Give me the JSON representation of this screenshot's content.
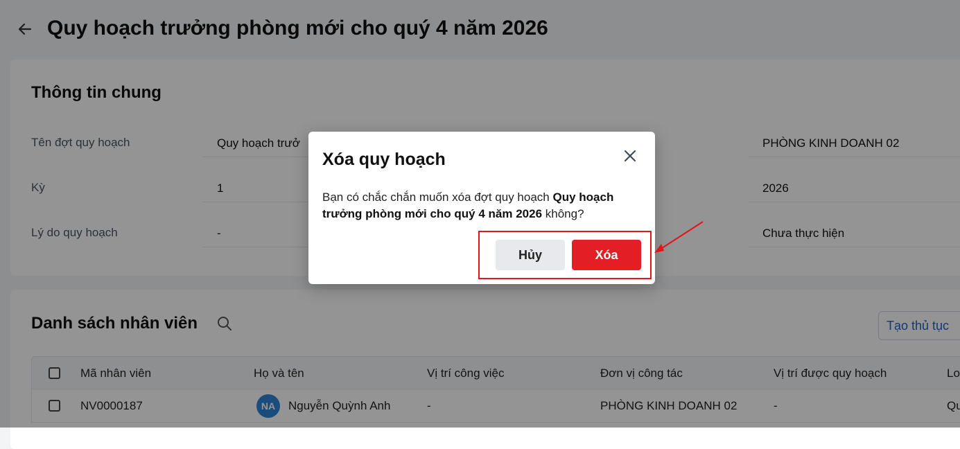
{
  "header": {
    "back_icon": "arrow-left-icon",
    "title": "Quy hoạch trưởng phòng mới cho quý 4 năm 2026"
  },
  "general_info": {
    "section_title": "Thông tin chung",
    "fields": [
      {
        "label": "Tên đợt quy hoạch",
        "value": "Quy hoạch trưở",
        "right_value": "PHÒNG KINH DOANH 02"
      },
      {
        "label": "Kỳ",
        "value": "1",
        "right_value": "2026"
      },
      {
        "label": "Lý do quy hoạch",
        "value": "-",
        "right_value": "Chưa thực hiện"
      }
    ]
  },
  "employee_list": {
    "section_title": "Danh sách nhân viên",
    "search_icon": "search-icon",
    "create_button": "Tạo thủ tục",
    "columns": [
      "Mã nhân viên",
      "Họ và tên",
      "Vị trí công việc",
      "Đơn vị công tác",
      "Vị trí được quy hoạch",
      "Lo"
    ],
    "rows": [
      {
        "code": "NV0000187",
        "avatar_initials": "NA",
        "name": "Nguyễn Quỳnh Anh",
        "position": "-",
        "unit": "PHÒNG KINH DOANH 02",
        "planned_position": "-",
        "last": "Qu"
      }
    ]
  },
  "dialog": {
    "title": "Xóa quy hoạch",
    "close_icon": "close-icon",
    "message_prefix": "Bạn có chắc chắn muốn xóa đợt quy hoạch ",
    "message_bold": "Quy hoạch trưởng phòng mới cho quý 4 năm 2026",
    "message_suffix": " không?",
    "cancel_label": "Hủy",
    "delete_label": "Xóa"
  },
  "colors": {
    "danger": "#e31e24",
    "annotation": "#e0161b",
    "link": "#1e63c8",
    "avatar": "#2f86d6"
  }
}
